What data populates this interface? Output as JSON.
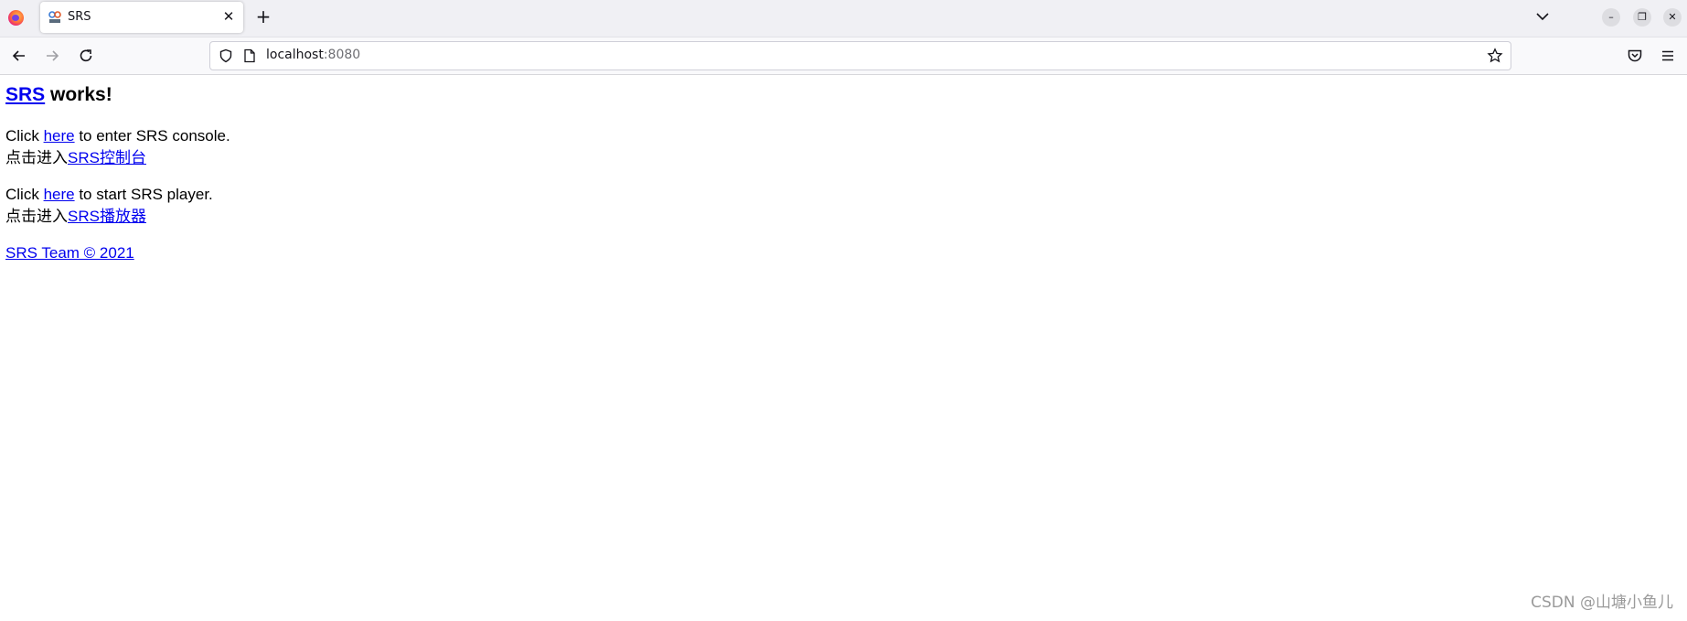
{
  "browser": {
    "tab": {
      "title": "SRS",
      "close_glyph": "✕"
    },
    "new_tab_glyph": "+",
    "window_controls": {
      "minimize": "–",
      "restore": "❐",
      "close": "✕"
    },
    "url": {
      "host": "localhost",
      "port": ":8080"
    },
    "icons": [
      "firefox-logo",
      "srs-favicon",
      "close-icon",
      "plus-icon",
      "chevron-down-icon",
      "back-arrow-icon",
      "forward-arrow-icon",
      "reload-icon",
      "shield-icon",
      "page-icon",
      "star-icon",
      "pocket-icon",
      "hamburger-menu-icon"
    ]
  },
  "page": {
    "heading": {
      "link": "SRS",
      "rest": " works!"
    },
    "console": {
      "prefix": "Click ",
      "link": "here",
      "suffix": " to enter SRS console.",
      "cn_prefix": "点击进入",
      "cn_link": "SRS控制台"
    },
    "player": {
      "prefix": "Click ",
      "link": "here",
      "suffix": " to start SRS player.",
      "cn_prefix": "点击进入",
      "cn_link": "SRS播放器"
    },
    "footer_link": "SRS Team © 2021"
  },
  "watermark": "CSDN @山塘小鱼儿",
  "colors": {
    "link": "#0000ee",
    "tabstrip": "#f0f0f4",
    "navbar": "#f9f9fb"
  }
}
